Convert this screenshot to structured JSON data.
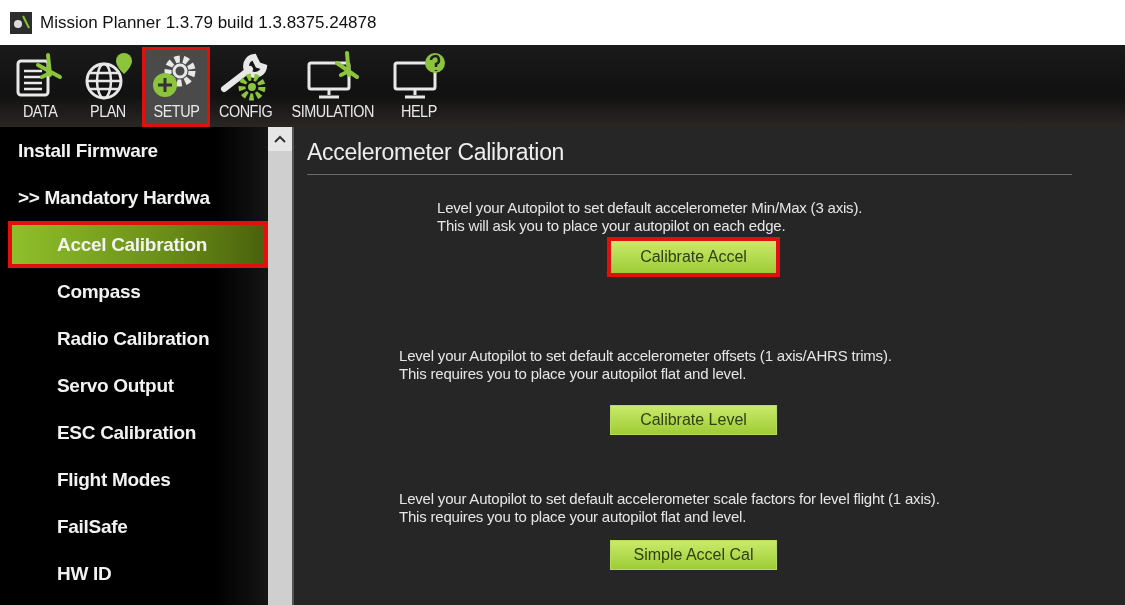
{
  "window": {
    "title": "Mission Planner 1.3.79 build 1.3.8375.24878"
  },
  "toolbar": [
    {
      "label": "DATA",
      "kind": "data",
      "selected": false,
      "highlighted": false
    },
    {
      "label": "PLAN",
      "kind": "plan",
      "selected": false,
      "highlighted": false
    },
    {
      "label": "SETUP",
      "kind": "setup",
      "selected": true,
      "highlighted": true
    },
    {
      "label": "CONFIG",
      "kind": "config",
      "selected": false,
      "highlighted": false
    },
    {
      "label": "SIMULATION",
      "kind": "simulation",
      "selected": false,
      "highlighted": false
    },
    {
      "label": "HELP",
      "kind": "help",
      "selected": false,
      "highlighted": false
    }
  ],
  "sidebar": {
    "items": [
      {
        "label": "Install Firmware",
        "selected": false,
        "highlighted": false
      },
      {
        "label": ">> Mandatory Hardwa",
        "selected": false,
        "highlighted": false,
        "children": [
          {
            "label": "Accel Calibration",
            "selected": true,
            "highlighted": true
          },
          {
            "label": "Compass",
            "selected": false,
            "highlighted": false
          },
          {
            "label": "Radio Calibration",
            "selected": false,
            "highlighted": false
          },
          {
            "label": "Servo Output",
            "selected": false,
            "highlighted": false
          },
          {
            "label": "ESC Calibration",
            "selected": false,
            "highlighted": false
          },
          {
            "label": "Flight Modes",
            "selected": false,
            "highlighted": false
          },
          {
            "label": "FailSafe",
            "selected": false,
            "highlighted": false
          },
          {
            "label": "HW ID",
            "selected": false,
            "highlighted": false
          }
        ]
      }
    ]
  },
  "content": {
    "heading": "Accelerometer Calibration",
    "sections": [
      {
        "lines": [
          "Level your Autopilot to set default accelerometer Min/Max (3 axis).",
          "This will ask you to place your autopilot on each edge."
        ],
        "button": {
          "label": "Calibrate Accel",
          "highlighted": true
        }
      },
      {
        "lines": [
          "Level your Autopilot to set default accelerometer offsets (1 axis/AHRS trims).",
          "This requires you to place your autopilot flat and level."
        ],
        "button": {
          "label": "Calibrate Level",
          "highlighted": false
        }
      },
      {
        "lines": [
          "Level your Autopilot to set default accelerometer scale factors for level flight (1 axis).",
          "This requires you to place your autopilot flat and level."
        ],
        "button": {
          "label": "Simple Accel Cal",
          "highlighted": false
        }
      }
    ]
  }
}
